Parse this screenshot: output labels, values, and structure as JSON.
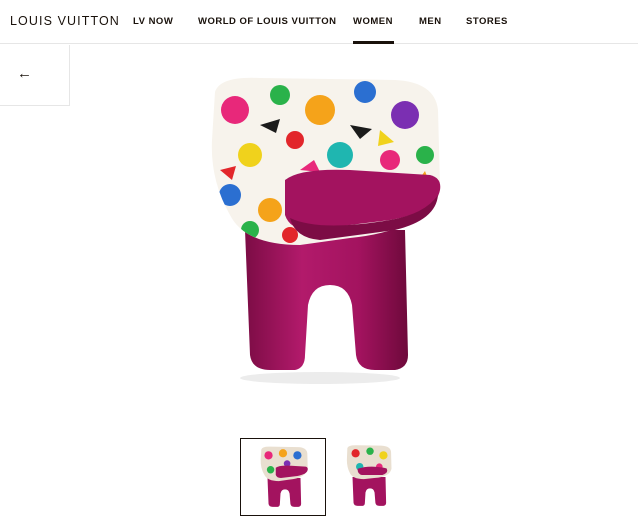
{
  "header": {
    "logo": "LOUIS VUITTON",
    "nav": [
      {
        "label": "LV NOW"
      },
      {
        "label": "WORLD OF LOUIS VUITTON"
      },
      {
        "label": "WOMEN",
        "active": true
      },
      {
        "label": "MEN"
      },
      {
        "label": "STORES"
      }
    ]
  },
  "back": {
    "icon": "arrow-left-icon",
    "glyph": "←"
  },
  "product": {
    "image": "colorful-embroidered-chair-image"
  },
  "gallery": {
    "thumbnails": [
      {
        "name": "chair-front-thumbnail",
        "selected": true
      },
      {
        "name": "chair-alt-thumbnail",
        "selected": false
      }
    ]
  },
  "colors": {
    "magenta": "#a3135f",
    "text": "#19110b"
  }
}
